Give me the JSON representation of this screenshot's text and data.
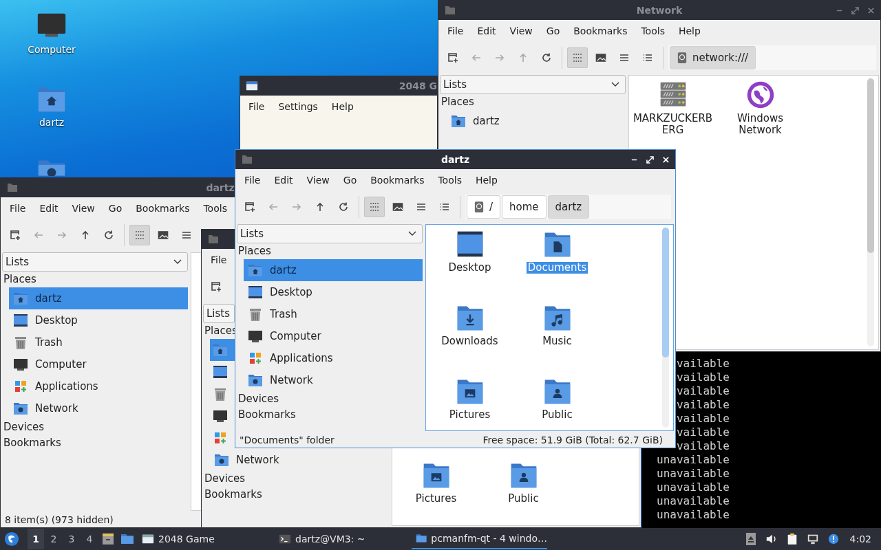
{
  "desktop": {
    "icons": [
      {
        "label": "Computer",
        "kind": "computer"
      },
      {
        "label": "dartz",
        "kind": "home"
      },
      {
        "kind": "network"
      }
    ]
  },
  "windows": [
    {
      "kind": "file-manager",
      "title": "Network",
      "active": false,
      "window_buttons": true,
      "menu": [
        "File",
        "Edit",
        "View",
        "Go",
        "Bookmarks",
        "Tools",
        "Help"
      ],
      "toolbar": [
        {
          "kind": "new-window",
          "disabled": false,
          "selected": false
        },
        {
          "kind": "back",
          "disabled": true,
          "selected": false
        },
        {
          "kind": "forward",
          "disabled": true,
          "selected": false
        },
        {
          "kind": "up",
          "disabled": true,
          "selected": false
        },
        {
          "kind": "reload",
          "disabled": false,
          "selected": false
        },
        {
          "kind": "icon-view",
          "disabled": false,
          "selected": true
        },
        {
          "kind": "thumbnail-view",
          "disabled": false,
          "selected": false
        },
        {
          "kind": "compact-view",
          "disabled": false,
          "selected": false
        },
        {
          "kind": "detailed-view",
          "disabled": false,
          "selected": false
        }
      ],
      "path": [
        {
          "label": "network:///",
          "kind": "root",
          "selected": true
        }
      ],
      "dropdown": "Lists",
      "sections": [
        {
          "label": "Places",
          "items": [
            {
              "label": "dartz",
              "kind": "home",
              "selected": false
            }
          ]
        }
      ],
      "files": [
        {
          "label": "MARKZUCKERBERG",
          "kind": "server",
          "selected": false
        },
        {
          "label": "Windows Network",
          "kind": "globe",
          "selected": false
        }
      ]
    },
    {
      "kind": "terminal",
      "lines": [
        "vailable",
        "vailable",
        "vailable",
        "vailable",
        "vailable",
        "vailable",
        "vailable",
        "unavailable",
        "unavailable",
        "unavailable",
        "unavailable",
        "unavailable"
      ]
    },
    {
      "kind": "game",
      "title": "2048 G",
      "menu": [
        "File",
        "Settings",
        "Help"
      ]
    },
    {
      "kind": "file-manager",
      "title": "dartz",
      "active": false,
      "menu": [
        "File",
        "Edit",
        "View",
        "Go",
        "Bookmarks",
        "Tools"
      ],
      "toolbar": [
        {
          "kind": "new-window",
          "disabled": false,
          "selected": false
        },
        {
          "kind": "back",
          "disabled": true,
          "selected": false
        },
        {
          "kind": "forward",
          "disabled": true,
          "selected": false
        },
        {
          "kind": "up",
          "disabled": false,
          "selected": false
        },
        {
          "kind": "reload",
          "disabled": false,
          "selected": false
        },
        {
          "kind": "icon-view",
          "disabled": false,
          "selected": true
        },
        {
          "kind": "thumbnail-view",
          "disabled": false,
          "selected": false
        },
        {
          "kind": "compact-view",
          "disabled": false,
          "selected": false
        }
      ],
      "dropdown": "Lists",
      "sections": [
        {
          "label": "Places",
          "items": [
            {
              "label": "dartz",
              "kind": "home",
              "selected": true
            },
            {
              "label": "Desktop",
              "kind": "desktop",
              "selected": false
            },
            {
              "label": "Trash",
              "kind": "trash",
              "selected": false
            },
            {
              "label": "Computer",
              "kind": "computer",
              "selected": false
            },
            {
              "label": "Applications",
              "kind": "applications",
              "selected": false
            },
            {
              "label": "Network",
              "kind": "network",
              "selected": false
            }
          ]
        },
        {
          "label": "Devices"
        },
        {
          "label": "Bookmarks"
        }
      ],
      "status": "8 item(s) (973 hidden)"
    },
    {
      "kind": "file-manager",
      "active": false,
      "menu": [
        "File"
      ],
      "toolbar": [
        {
          "kind": "new-window",
          "disabled": false,
          "selected": false
        }
      ],
      "dropdown": "Lists",
      "sections": [
        {
          "label": "Places",
          "items": [
            {
              "kind": "home",
              "selected": true
            },
            {
              "kind": "desktop",
              "selected": false
            },
            {
              "kind": "trash",
              "selected": false
            },
            {
              "kind": "computer",
              "selected": false
            },
            {
              "kind": "applications",
              "selected": false
            },
            {
              "label": "Network",
              "kind": "network",
              "selected": false
            }
          ]
        },
        {
          "label": "Devices"
        },
        {
          "label": "Bookmarks"
        }
      ],
      "files": [
        {
          "label": "Pictures",
          "kind": "pictures",
          "selected": false
        },
        {
          "label": "Public",
          "kind": "public",
          "selected": false
        }
      ]
    },
    {
      "kind": "file-manager",
      "title": "dartz",
      "active": true,
      "window_buttons": true,
      "menu": [
        "File",
        "Edit",
        "View",
        "Go",
        "Bookmarks",
        "Tools",
        "Help"
      ],
      "toolbar": [
        {
          "kind": "new-window",
          "disabled": false,
          "selected": false
        },
        {
          "kind": "back",
          "disabled": true,
          "selected": false
        },
        {
          "kind": "forward",
          "disabled": true,
          "selected": false
        },
        {
          "kind": "up",
          "disabled": false,
          "selected": false
        },
        {
          "kind": "reload",
          "disabled": false,
          "selected": false
        },
        {
          "kind": "icon-view",
          "disabled": false,
          "selected": true
        },
        {
          "kind": "thumbnail-view",
          "disabled": false,
          "selected": false
        },
        {
          "kind": "compact-view",
          "disabled": false,
          "selected": false
        },
        {
          "kind": "detailed-view",
          "disabled": false,
          "selected": false
        }
      ],
      "path": [
        {
          "label": "/",
          "kind": "root",
          "selected": false
        },
        {
          "label": "home",
          "kind": "folder",
          "selected": false
        },
        {
          "label": "dartz",
          "kind": "folder",
          "selected": true
        }
      ],
      "dropdown": "Lists",
      "sections": [
        {
          "label": "Places",
          "items": [
            {
              "label": "dartz",
              "kind": "home",
              "selected": true
            },
            {
              "label": "Desktop",
              "kind": "desktop",
              "selected": false
            },
            {
              "label": "Trash",
              "kind": "trash",
              "selected": false
            },
            {
              "label": "Computer",
              "kind": "computer",
              "selected": false
            },
            {
              "label": "Applications",
              "kind": "applications",
              "selected": false
            },
            {
              "label": "Network",
              "kind": "network",
              "selected": false
            }
          ]
        },
        {
          "label": "Devices"
        },
        {
          "label": "Bookmarks"
        }
      ],
      "files": [
        {
          "label": "Desktop",
          "kind": "desktop",
          "selected": false
        },
        {
          "label": "Documents",
          "kind": "documents",
          "selected": true
        },
        {
          "label": "Downloads",
          "kind": "downloads",
          "selected": false
        },
        {
          "label": "Music",
          "kind": "music",
          "selected": false
        },
        {
          "label": "Pictures",
          "kind": "pictures",
          "selected": false
        },
        {
          "label": "Public",
          "kind": "public",
          "selected": false
        }
      ],
      "status": "\"Documents\" folder",
      "free_space": "Free space: 51.9 GiB (Total: 62.7 GiB)"
    }
  ],
  "taskbar": {
    "workspaces": [
      {
        "label": "1",
        "selected": true
      },
      {
        "label": "2",
        "selected": false
      },
      {
        "label": "3",
        "selected": false
      },
      {
        "label": "4",
        "selected": false
      }
    ],
    "tasks": [
      {
        "label": "2048 Game",
        "kind": "window",
        "selected": false
      },
      {
        "label": "dartz@VM3: ~",
        "kind": "terminal",
        "selected": false
      },
      {
        "label": "pcmanfm-qt - 4 windo…",
        "kind": "folder",
        "selected": true
      }
    ],
    "clock": "4:02"
  }
}
